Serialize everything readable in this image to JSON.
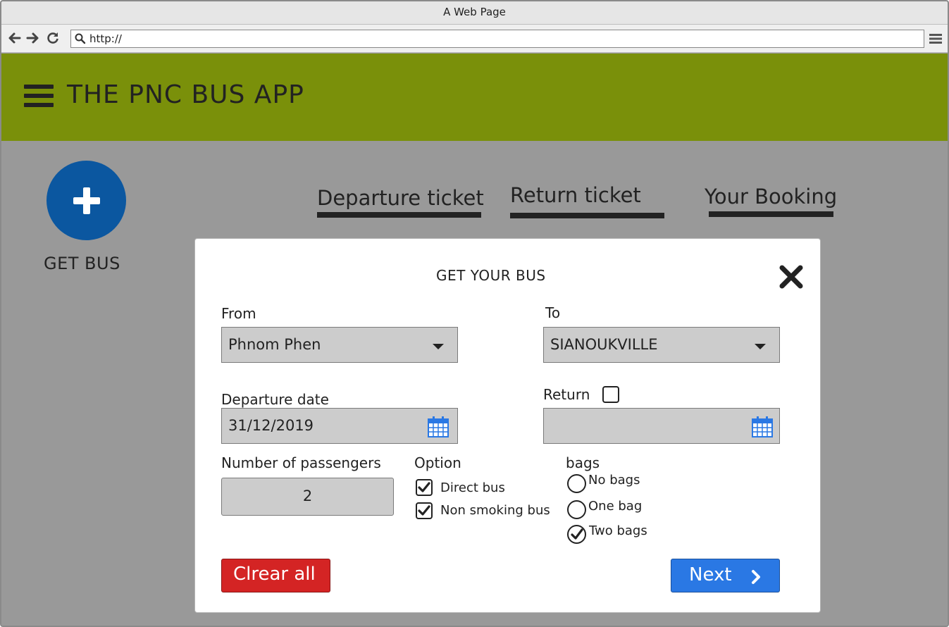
{
  "window": {
    "title": "A Web Page"
  },
  "browser": {
    "url": "http://",
    "icons": [
      "arrow-left-icon",
      "arrow-right-icon",
      "reload-icon",
      "search-icon",
      "menu-icon"
    ]
  },
  "header": {
    "title": "THE PNC BUS APP",
    "background": "#7a900a",
    "menu_icon": "hamburger-icon"
  },
  "fab": {
    "label": "GET BUS",
    "icon": "plus-icon",
    "color": "#0b57a0"
  },
  "tabs": [
    {
      "label": "Departure ticket"
    },
    {
      "label": "Return ticket"
    },
    {
      "label": "Your Booking"
    }
  ],
  "dialog": {
    "title": "GET YOUR BUS",
    "close_icon": "close-icon",
    "from": {
      "label": "From",
      "value": "Phnom Phen"
    },
    "to": {
      "label": "To",
      "value": "SIANOUKVILLE"
    },
    "departure_date": {
      "label": "Departure date",
      "value": "31/12/2019"
    },
    "return": {
      "label": "Return",
      "checked": false,
      "value": ""
    },
    "passengers": {
      "label": "Number of passengers",
      "value": "2"
    },
    "options": {
      "label": "Option",
      "items": [
        {
          "label": "Direct bus",
          "checked": true
        },
        {
          "label": "Non smoking bus",
          "checked": true
        }
      ]
    },
    "bags": {
      "label": "bags",
      "items": [
        {
          "label": "No bags",
          "selected": false
        },
        {
          "label": "One bag",
          "selected": false
        },
        {
          "label": "Two bags",
          "selected": true
        }
      ]
    },
    "clear_button": {
      "label": "Clrear all",
      "color": "#d42424"
    },
    "next_button": {
      "label": "Next",
      "color": "#2a78e4"
    }
  }
}
